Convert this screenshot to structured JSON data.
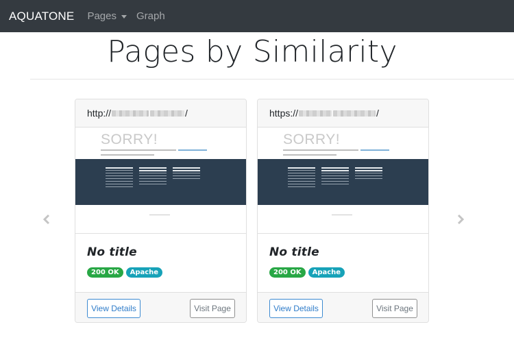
{
  "navbar": {
    "brand": "AQUATONE",
    "pages_label": "Pages",
    "graph_label": "Graph"
  },
  "title": "Pages by Similarity",
  "cards": [
    {
      "url_prefix": "http://",
      "url_suffix": "/",
      "screenshot": {
        "heading": "SORRY!"
      },
      "page_title": "No title",
      "badges": [
        {
          "label": "200 OK",
          "color": "#28a745"
        },
        {
          "label": "Apache",
          "color": "#17a2b8"
        }
      ],
      "details_label": "View Details",
      "visit_label": "Visit Page"
    },
    {
      "url_prefix": "https://",
      "url_suffix": "/",
      "screenshot": {
        "heading": "SORRY!"
      },
      "page_title": "No title",
      "badges": [
        {
          "label": "200 OK",
          "color": "#28a745"
        },
        {
          "label": "Apache",
          "color": "#17a2b8"
        }
      ],
      "details_label": "View Details",
      "visit_label": "Visit Page"
    }
  ],
  "carousel": {
    "prev_icon": "chevron-left-icon",
    "next_icon": "chevron-right-icon"
  }
}
